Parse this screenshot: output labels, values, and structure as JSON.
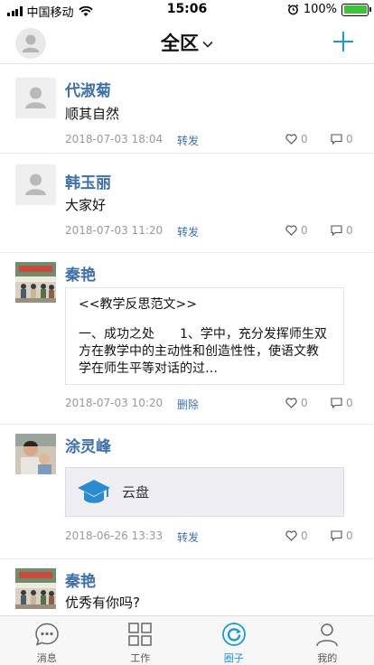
{
  "status_bar": {
    "carrier": "中国移动",
    "time": "15:06",
    "battery": "100%"
  },
  "nav": {
    "title": "全区"
  },
  "posts": [
    {
      "name": "代淑菊",
      "text": "顺其自然",
      "time": "2018-07-03 18:04",
      "action": "转发",
      "likes": "0",
      "comments": "0"
    },
    {
      "name": "韩玉丽",
      "text": "大家好",
      "time": "2018-07-03 11:20",
      "action": "转发",
      "likes": "0",
      "comments": "0"
    },
    {
      "name": "秦艳",
      "article_title": "<<教学反思范文>>",
      "article_body": "一、成功之处　　1、学中，充分发挥师生双方在教学中的主动性和创造性性，使语文教学在师生平等对话的过…",
      "time": "2018-07-03 10:20",
      "action": "删除",
      "likes": "0",
      "comments": "0"
    },
    {
      "name": "涂灵峰",
      "file_label": "云盘",
      "time": "2018-06-26 13:33",
      "action": "转发",
      "likes": "0",
      "comments": "0"
    },
    {
      "name": "秦艳",
      "text": "优秀有你吗?"
    }
  ],
  "tabbar": {
    "tabs": [
      {
        "label": "消息"
      },
      {
        "label": "工作"
      },
      {
        "label": "圈子"
      },
      {
        "label": "我的"
      }
    ]
  },
  "colors": {
    "accent": "#1a9ad6",
    "name": "#3f6fa8"
  }
}
